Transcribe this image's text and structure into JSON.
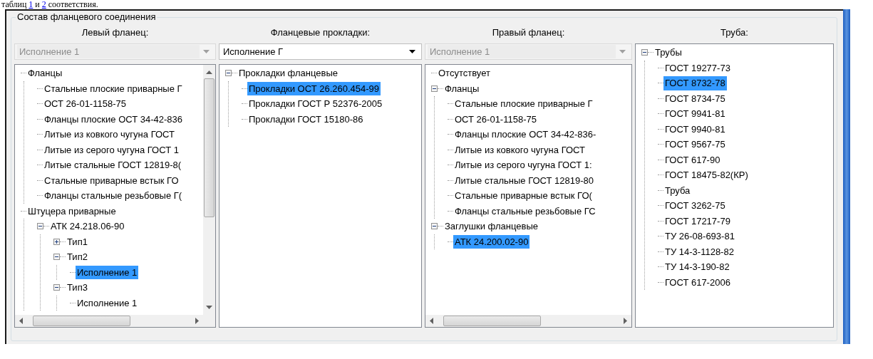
{
  "document_text": {
    "before": "таблиц ",
    "link_1": "1",
    "middle": " и ",
    "link_2": "2",
    "after": " соответствия."
  },
  "group": {
    "title": "Состав фланцевого соединения"
  },
  "columns": [
    {
      "heading": "Левый фланец:",
      "combo": {
        "value": "Исполнение 1",
        "disabled": true
      },
      "scroll": {
        "vertical": true,
        "horizontal": true
      },
      "tree": [
        {
          "label": "Фланцы",
          "selected": false,
          "children": [
            {
              "label": "Стальные плоские приварные Г",
              "selected": false
            },
            {
              "label": "ОСТ 26-01-1158-75",
              "selected": false
            },
            {
              "label": "Фланцы плоские ОСТ 34-42-836",
              "selected": false
            },
            {
              "label": "Литые из ковкого чугуна ГОСТ",
              "selected": false
            },
            {
              "label": "Литые из серого чугуна ГОСТ 1",
              "selected": false
            },
            {
              "label": "Литые стальные ГОСТ 12819-8(",
              "selected": false
            },
            {
              "label": "Стальные приварные встык ГО",
              "selected": false
            },
            {
              "label": "Фланцы стальные резьбовые Г(",
              "selected": false
            }
          ]
        },
        {
          "label": "Штуцера приварные",
          "selected": false,
          "children": [
            {
              "label": "АТК 24.218.06-90",
              "selected": false,
              "expanded": true,
              "children": [
                {
                  "label": "Тип1",
                  "selected": false,
                  "expanded": false
                },
                {
                  "label": "Тип2",
                  "selected": false,
                  "expanded": true,
                  "children": [
                    {
                      "label": "Исполнение 1",
                      "selected": true
                    }
                  ]
                },
                {
                  "label": "Тип3",
                  "selected": false,
                  "expanded": true,
                  "children": [
                    {
                      "label": "Исполнение 1",
                      "selected": false
                    }
                  ]
                }
              ]
            }
          ]
        }
      ]
    },
    {
      "heading": "Фланцевые прокладки:",
      "combo": {
        "value": "Исполнение Г",
        "disabled": false
      },
      "scroll": {
        "vertical": false,
        "horizontal": false
      },
      "tree": [
        {
          "label": "Прокладки фланцевые",
          "selected": false,
          "expanded": true,
          "children": [
            {
              "label": "Прокладки ОСТ 26.260.454-99",
              "selected": true
            },
            {
              "label": "Прокладки ГОСТ Р 52376-2005",
              "selected": false
            },
            {
              "label": "Прокладки ГОСТ 15180-86",
              "selected": false
            }
          ]
        }
      ]
    },
    {
      "heading": "Правый фланец:",
      "combo": {
        "value": "Исполнение 1",
        "disabled": true
      },
      "scroll": {
        "vertical": false,
        "horizontal": true
      },
      "tree": [
        {
          "label": "Отсутствует",
          "selected": false
        },
        {
          "label": "Фланцы",
          "selected": false,
          "expanded": true,
          "children": [
            {
              "label": "Стальные плоские приварные Г",
              "selected": false
            },
            {
              "label": "ОСТ 26-01-1158-75",
              "selected": false
            },
            {
              "label": "Фланцы плоские ОСТ 34-42-836-",
              "selected": false
            },
            {
              "label": "Литые из ковкого чугуна ГОСТ",
              "selected": false
            },
            {
              "label": "Литые из серого чугуна ГОСТ 1:",
              "selected": false
            },
            {
              "label": "Литые стальные ГОСТ 12819-80",
              "selected": false
            },
            {
              "label": "Стальные приварные встык ГО(",
              "selected": false
            },
            {
              "label": "Фланцы стальные резьбовые ГС",
              "selected": false
            }
          ]
        },
        {
          "label": "Заглушки фланцевые",
          "selected": false,
          "expanded": true,
          "children": [
            {
              "label": "АТК 24.200.02-90",
              "selected": true
            }
          ]
        }
      ]
    },
    {
      "heading": "Труба:",
      "scroll": {
        "vertical": false,
        "horizontal": false
      },
      "tree": [
        {
          "label": "Трубы",
          "selected": false,
          "expanded": true,
          "children": [
            {
              "label": "ГОСТ 19277-73",
              "selected": false
            },
            {
              "label": "ГОСТ 8732-78",
              "selected": true
            },
            {
              "label": "ГОСТ 8734-75",
              "selected": false
            },
            {
              "label": "ГОСТ 9941-81",
              "selected": false
            },
            {
              "label": "ГОСТ 9940-81",
              "selected": false
            },
            {
              "label": "ГОСТ 9567-75",
              "selected": false
            },
            {
              "label": "ГОСТ 617-90",
              "selected": false
            },
            {
              "label": "ГОСТ 18475-82(КР)",
              "selected": false
            },
            {
              "label": "Труба",
              "selected": false
            },
            {
              "label": "ГОСТ 3262-75",
              "selected": false
            },
            {
              "label": "ГОСТ 17217-79",
              "selected": false
            },
            {
              "label": "ТУ 26-08-693-81",
              "selected": false
            },
            {
              "label": "ТУ 14-3-1128-82",
              "selected": false
            },
            {
              "label": "ТУ 14-3-190-82",
              "selected": false
            },
            {
              "label": "ГОСТ 617-2006",
              "selected": false
            }
          ]
        }
      ]
    }
  ]
}
